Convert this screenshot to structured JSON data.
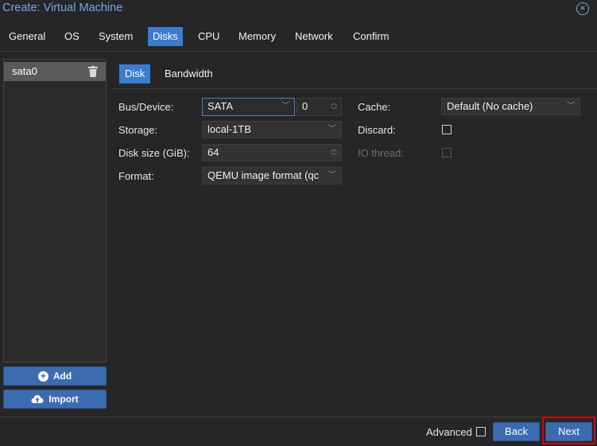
{
  "window": {
    "title": "Create: Virtual Machine"
  },
  "tabs": [
    {
      "label": "General"
    },
    {
      "label": "OS"
    },
    {
      "label": "System"
    },
    {
      "label": "Disks"
    },
    {
      "label": "CPU"
    },
    {
      "label": "Memory"
    },
    {
      "label": "Network"
    },
    {
      "label": "Confirm"
    }
  ],
  "active_tab": "Disks",
  "disk_list": {
    "items": [
      {
        "label": "sata0"
      }
    ]
  },
  "left_buttons": {
    "add": "Add",
    "import": "Import"
  },
  "subtabs": [
    {
      "label": "Disk"
    },
    {
      "label": "Bandwidth"
    }
  ],
  "form": {
    "bus_device": {
      "label": "Bus/Device:",
      "value": "SATA",
      "index": "0"
    },
    "storage": {
      "label": "Storage:",
      "value": "local-1TB"
    },
    "disk_size": {
      "label": "Disk size (GiB):",
      "value": "64"
    },
    "format": {
      "label": "Format:",
      "value": "QEMU image format (qc"
    },
    "cache": {
      "label": "Cache:",
      "value": "Default (No cache)"
    },
    "discard": {
      "label": "Discard:",
      "checked": false
    },
    "io_thread": {
      "label": "IO thread:",
      "checked": false,
      "disabled": true
    }
  },
  "footer": {
    "advanced_label": "Advanced",
    "advanced_checked": false,
    "back": "Back",
    "next": "Next"
  },
  "colors": {
    "accent": "#3b7bd1",
    "title": "#6fa8e6",
    "highlight": "#e00000"
  }
}
